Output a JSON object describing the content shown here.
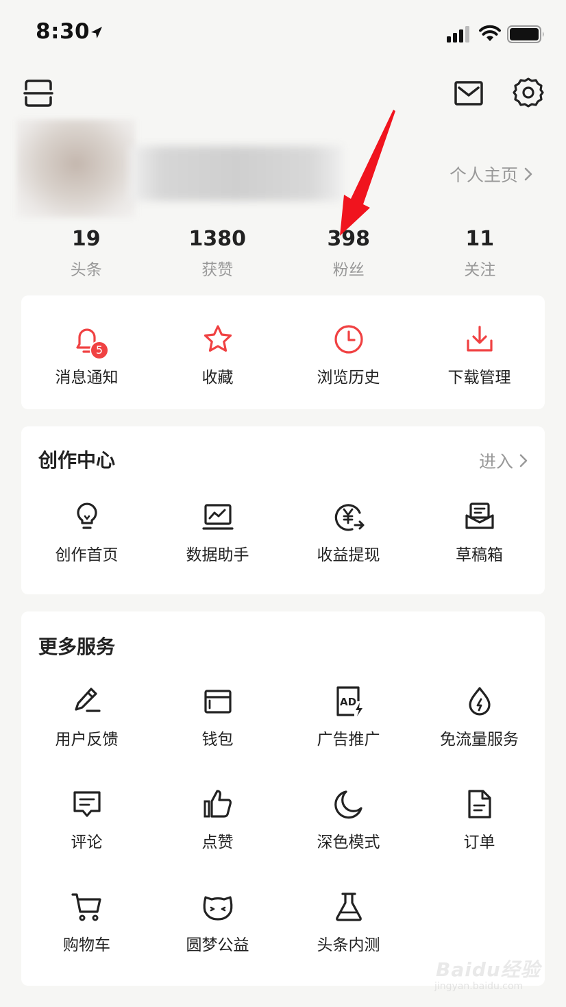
{
  "status_bar": {
    "time": "8:30"
  },
  "profile": {
    "home_link": "个人主页"
  },
  "stats": [
    {
      "value": "19",
      "label": "头条"
    },
    {
      "value": "1380",
      "label": "获赞"
    },
    {
      "value": "398",
      "label": "粉丝"
    },
    {
      "value": "11",
      "label": "关注"
    }
  ],
  "quick_actions": [
    {
      "label": "消息通知",
      "icon": "bell-icon",
      "badge": "5"
    },
    {
      "label": "收藏",
      "icon": "star-icon"
    },
    {
      "label": "浏览历史",
      "icon": "clock-icon"
    },
    {
      "label": "下载管理",
      "icon": "download-icon"
    }
  ],
  "creation_center": {
    "title": "创作中心",
    "enter_label": "进入",
    "items": [
      {
        "label": "创作首页",
        "icon": "lightbulb-icon"
      },
      {
        "label": "数据助手",
        "icon": "chart-monitor-icon"
      },
      {
        "label": "收益提现",
        "icon": "yen-withdraw-icon"
      },
      {
        "label": "草稿箱",
        "icon": "draft-box-icon"
      }
    ]
  },
  "more_services": {
    "title": "更多服务",
    "items": [
      {
        "label": "用户反馈",
        "icon": "pencil-icon"
      },
      {
        "label": "钱包",
        "icon": "wallet-icon"
      },
      {
        "label": "广告推广",
        "icon": "ad-icon"
      },
      {
        "label": "免流量服务",
        "icon": "data-drop-icon"
      },
      {
        "label": "评论",
        "icon": "comment-icon"
      },
      {
        "label": "点赞",
        "icon": "thumbs-up-icon"
      },
      {
        "label": "深色模式",
        "icon": "moon-icon"
      },
      {
        "label": "订单",
        "icon": "order-icon"
      },
      {
        "label": "购物车",
        "icon": "cart-icon"
      },
      {
        "label": "圆梦公益",
        "icon": "charity-cat-icon"
      },
      {
        "label": "头条内测",
        "icon": "flask-icon"
      }
    ]
  },
  "watermark": {
    "brand": "Baidu经验",
    "url": "jingyan.baidu.com"
  },
  "colors": {
    "accent": "#f04142",
    "background": "#f6f6f4",
    "muted_text": "#999999"
  }
}
